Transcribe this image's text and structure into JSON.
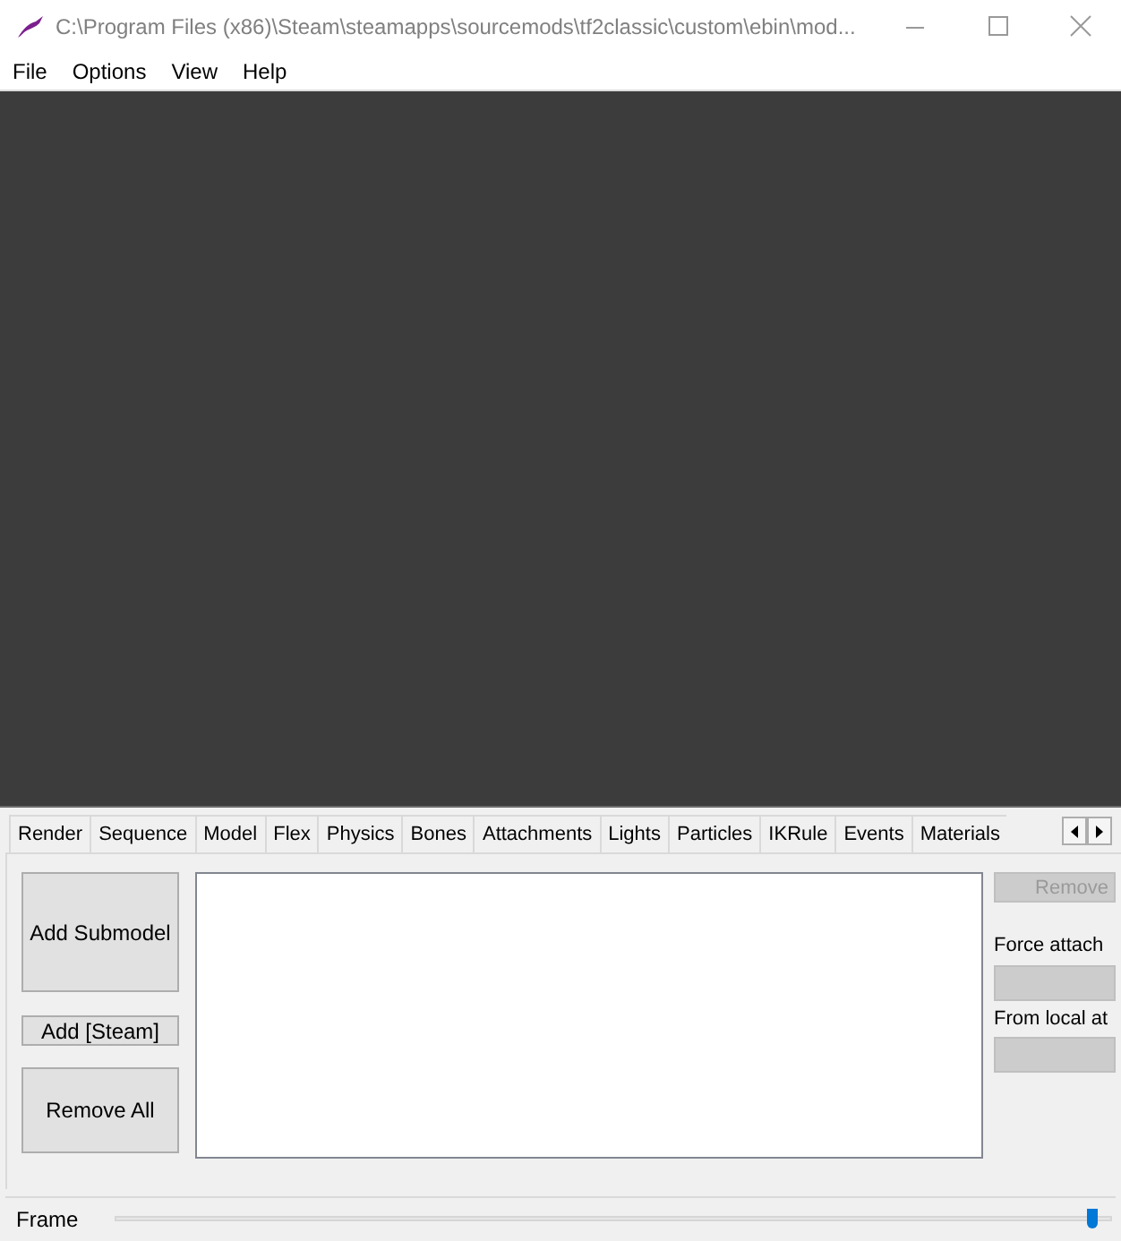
{
  "window": {
    "title": "C:\\Program Files (x86)\\Steam\\steamapps\\sourcemods\\tf2classic\\custom\\ebin\\mod..."
  },
  "menu": [
    "File",
    "Options",
    "View",
    "Help"
  ],
  "tabs": [
    "Render",
    "Sequence",
    "Model",
    "Flex",
    "Physics",
    "Bones",
    "Attachments",
    "Lights",
    "Particles",
    "IKRule",
    "Events",
    "Materials"
  ],
  "model_panel": {
    "add_submodel": "Add Submodel",
    "add_steam": "Add [Steam]",
    "remove_all": "Remove All",
    "remove": {
      "label": "Remove",
      "disabled": true
    },
    "force_attach": {
      "label": "Force attach",
      "disabled": true
    },
    "from_local": {
      "label": "From local at",
      "disabled": true
    }
  },
  "frame": {
    "label": "Frame",
    "level": 0.985
  }
}
